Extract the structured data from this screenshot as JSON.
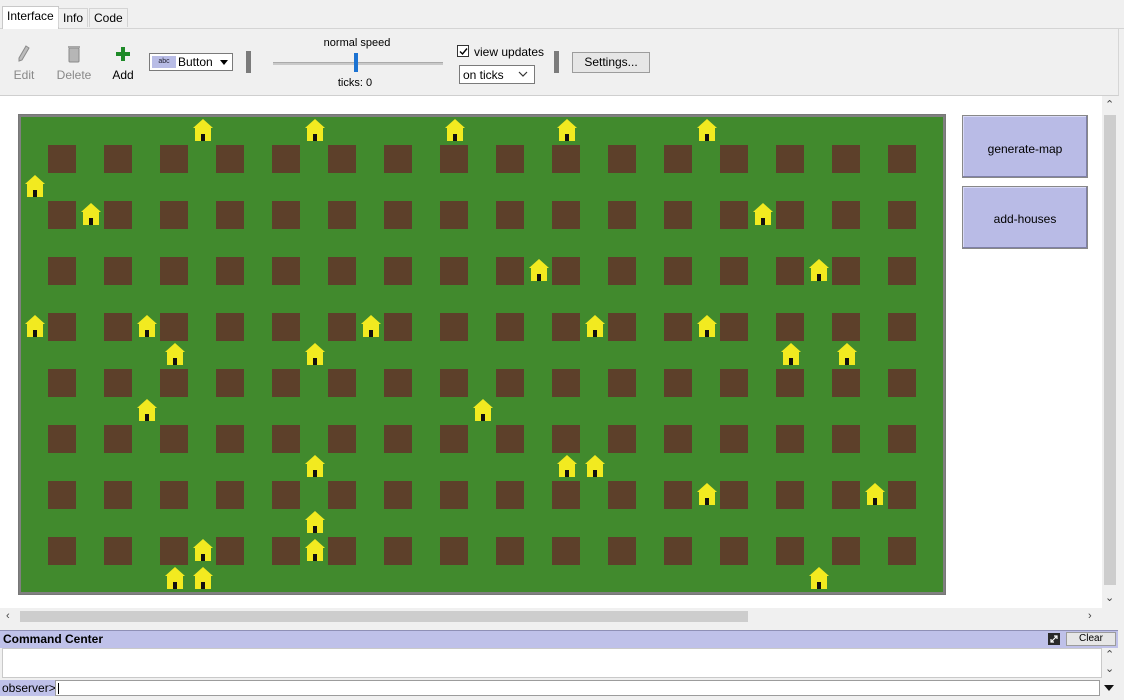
{
  "tabs": [
    {
      "label": "Interface",
      "active": true
    },
    {
      "label": "Info",
      "active": false
    },
    {
      "label": "Code",
      "active": false
    }
  ],
  "toolbar": {
    "edit_label": "Edit",
    "delete_label": "Delete",
    "add_label": "Add",
    "widget_type": "Button",
    "widget_chip": "abc",
    "speed_label": "normal speed",
    "speed_level": 0.5,
    "ticks_label": "ticks: 0",
    "view_updates_label": "view updates",
    "view_updates_checked": true,
    "update_mode": "on ticks",
    "settings_label": "Settings..."
  },
  "world": {
    "background_color": "#418a2d",
    "plot_color": "#5d402a",
    "house_color": "#f2ea20",
    "plot_columns": 16,
    "plot_rows": 8,
    "houses": [
      {
        "col": 6,
        "row": 0
      },
      {
        "col": 10,
        "row": 0
      },
      {
        "col": 15,
        "row": 0
      },
      {
        "col": 19,
        "row": 0
      },
      {
        "col": 24,
        "row": 0
      },
      {
        "col": 0,
        "row": 2
      },
      {
        "col": 2,
        "row": 3
      },
      {
        "col": 26,
        "row": 3
      },
      {
        "col": 18,
        "row": 5
      },
      {
        "col": 28,
        "row": 5
      },
      {
        "col": 0,
        "row": 7
      },
      {
        "col": 4,
        "row": 7
      },
      {
        "col": 12,
        "row": 7
      },
      {
        "col": 20,
        "row": 7
      },
      {
        "col": 24,
        "row": 7
      },
      {
        "col": 5,
        "row": 8
      },
      {
        "col": 10,
        "row": 8
      },
      {
        "col": 27,
        "row": 8
      },
      {
        "col": 29,
        "row": 8
      },
      {
        "col": 4,
        "row": 10
      },
      {
        "col": 16,
        "row": 10
      },
      {
        "col": 10,
        "row": 12
      },
      {
        "col": 19,
        "row": 12
      },
      {
        "col": 20,
        "row": 12
      },
      {
        "col": 24,
        "row": 13
      },
      {
        "col": 30,
        "row": 13
      },
      {
        "col": 10,
        "row": 14
      },
      {
        "col": 6,
        "row": 15
      },
      {
        "col": 10,
        "row": 15
      },
      {
        "col": 5,
        "row": 16
      },
      {
        "col": 6,
        "row": 16
      },
      {
        "col": 28,
        "row": 16
      }
    ]
  },
  "buttons": {
    "generate_map": "generate-map",
    "add_houses": "add-houses"
  },
  "command_center": {
    "title": "Command Center",
    "clear_label": "Clear",
    "prompt": "observer>",
    "input_value": ""
  }
}
